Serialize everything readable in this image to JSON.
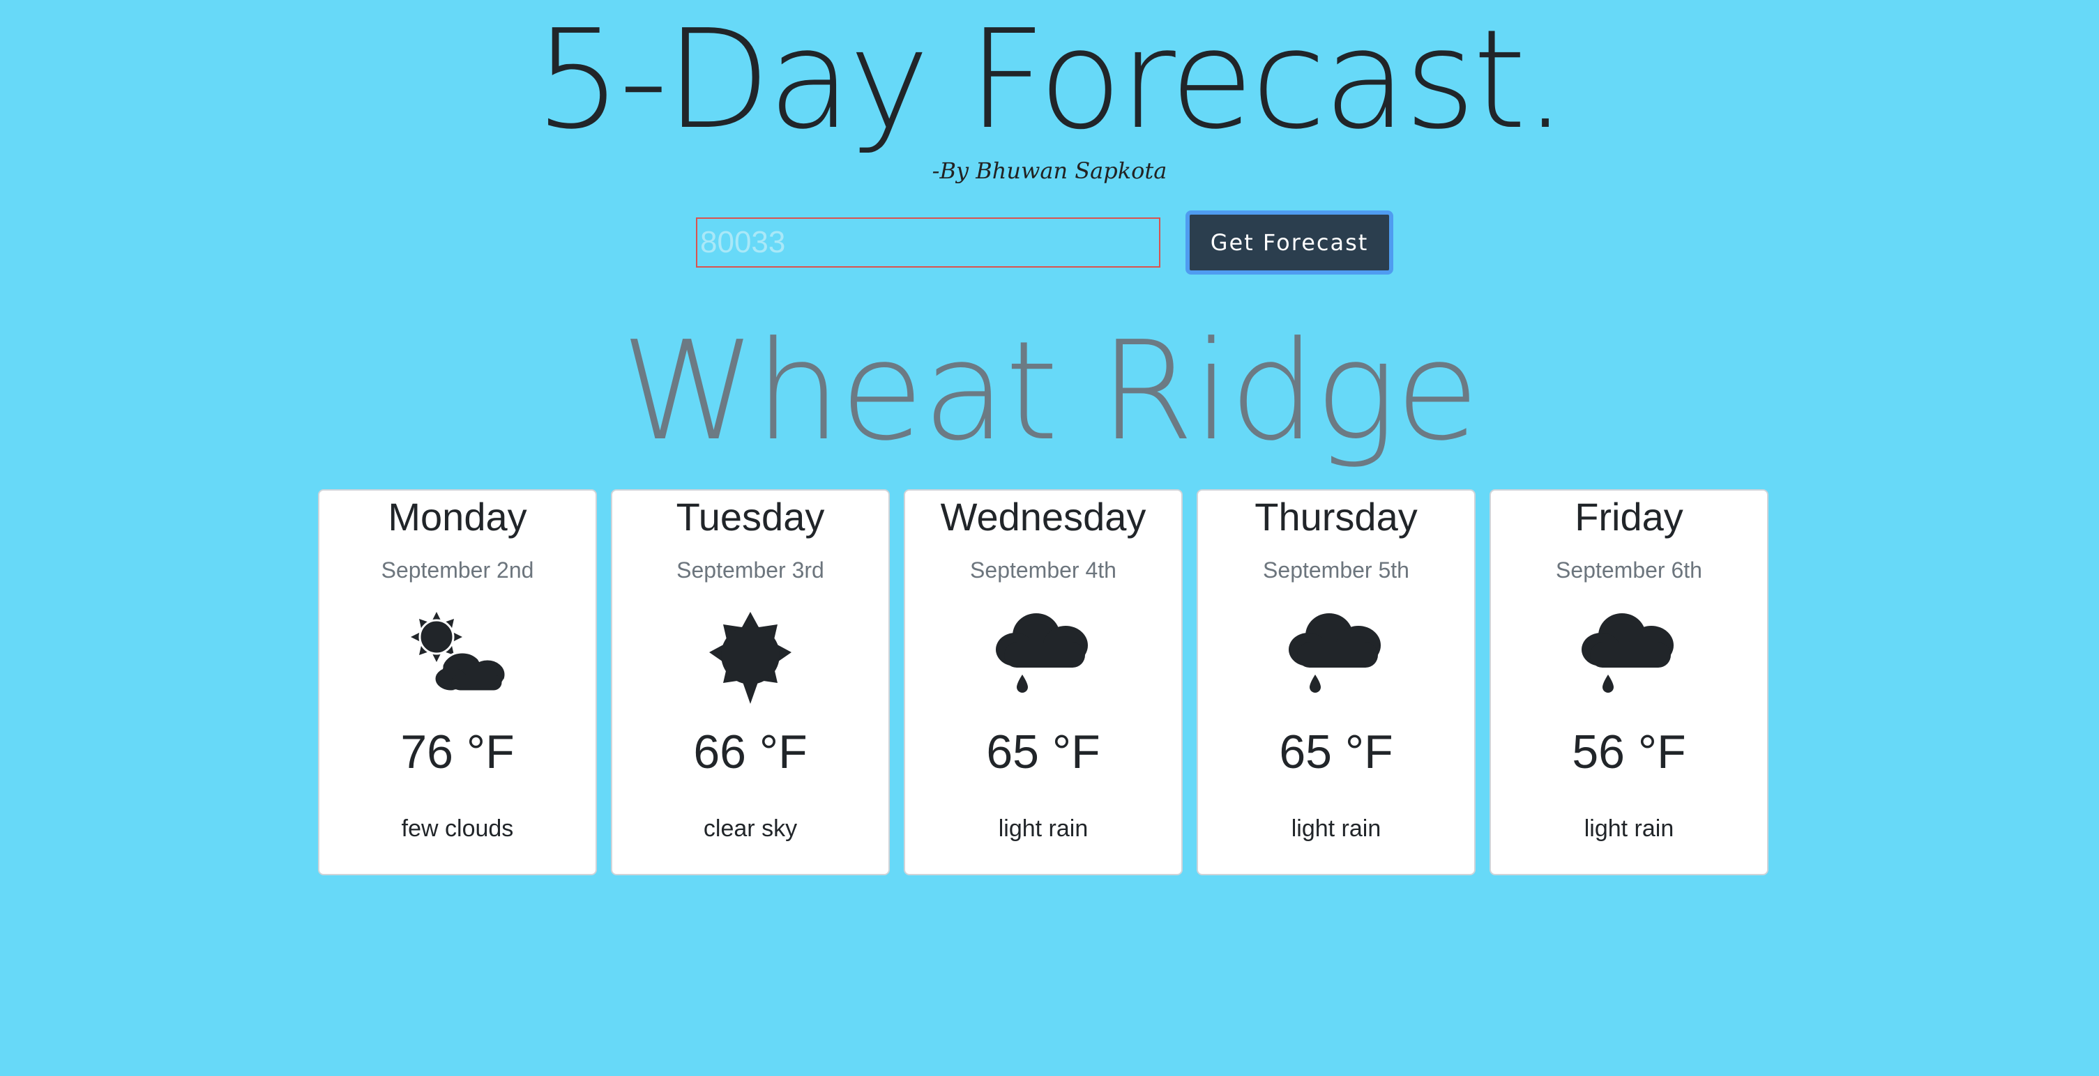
{
  "header": {
    "title": "5-Day Forecast.",
    "byline": "-By Bhuwan Sapkota"
  },
  "search": {
    "placeholder": "80033",
    "value": "",
    "button_label": "Get Forecast"
  },
  "city": "Wheat Ridge",
  "forecast": [
    {
      "day": "Monday",
      "date": "September 2nd",
      "icon": "sun-behind-clouds-icon",
      "temp": "76 °F",
      "description": "few clouds"
    },
    {
      "day": "Tuesday",
      "date": "September 3rd",
      "icon": "sun-icon",
      "temp": "66 °F",
      "description": "clear sky"
    },
    {
      "day": "Wednesday",
      "date": "September 4th",
      "icon": "rain-cloud-icon",
      "temp": "65 °F",
      "description": "light rain"
    },
    {
      "day": "Thursday",
      "date": "September 5th",
      "icon": "rain-cloud-icon",
      "temp": "65 °F",
      "description": "light rain"
    },
    {
      "day": "Friday",
      "date": "September 6th",
      "icon": "rain-cloud-icon",
      "temp": "56 °F",
      "description": "light rain"
    }
  ],
  "colors": {
    "background": "#67d9f8",
    "button": "#2b3e4e",
    "button_focus_ring": "#4f9cf0",
    "input_border": "#d9534f",
    "city_text": "#6c7a84",
    "icon": "#212529"
  }
}
